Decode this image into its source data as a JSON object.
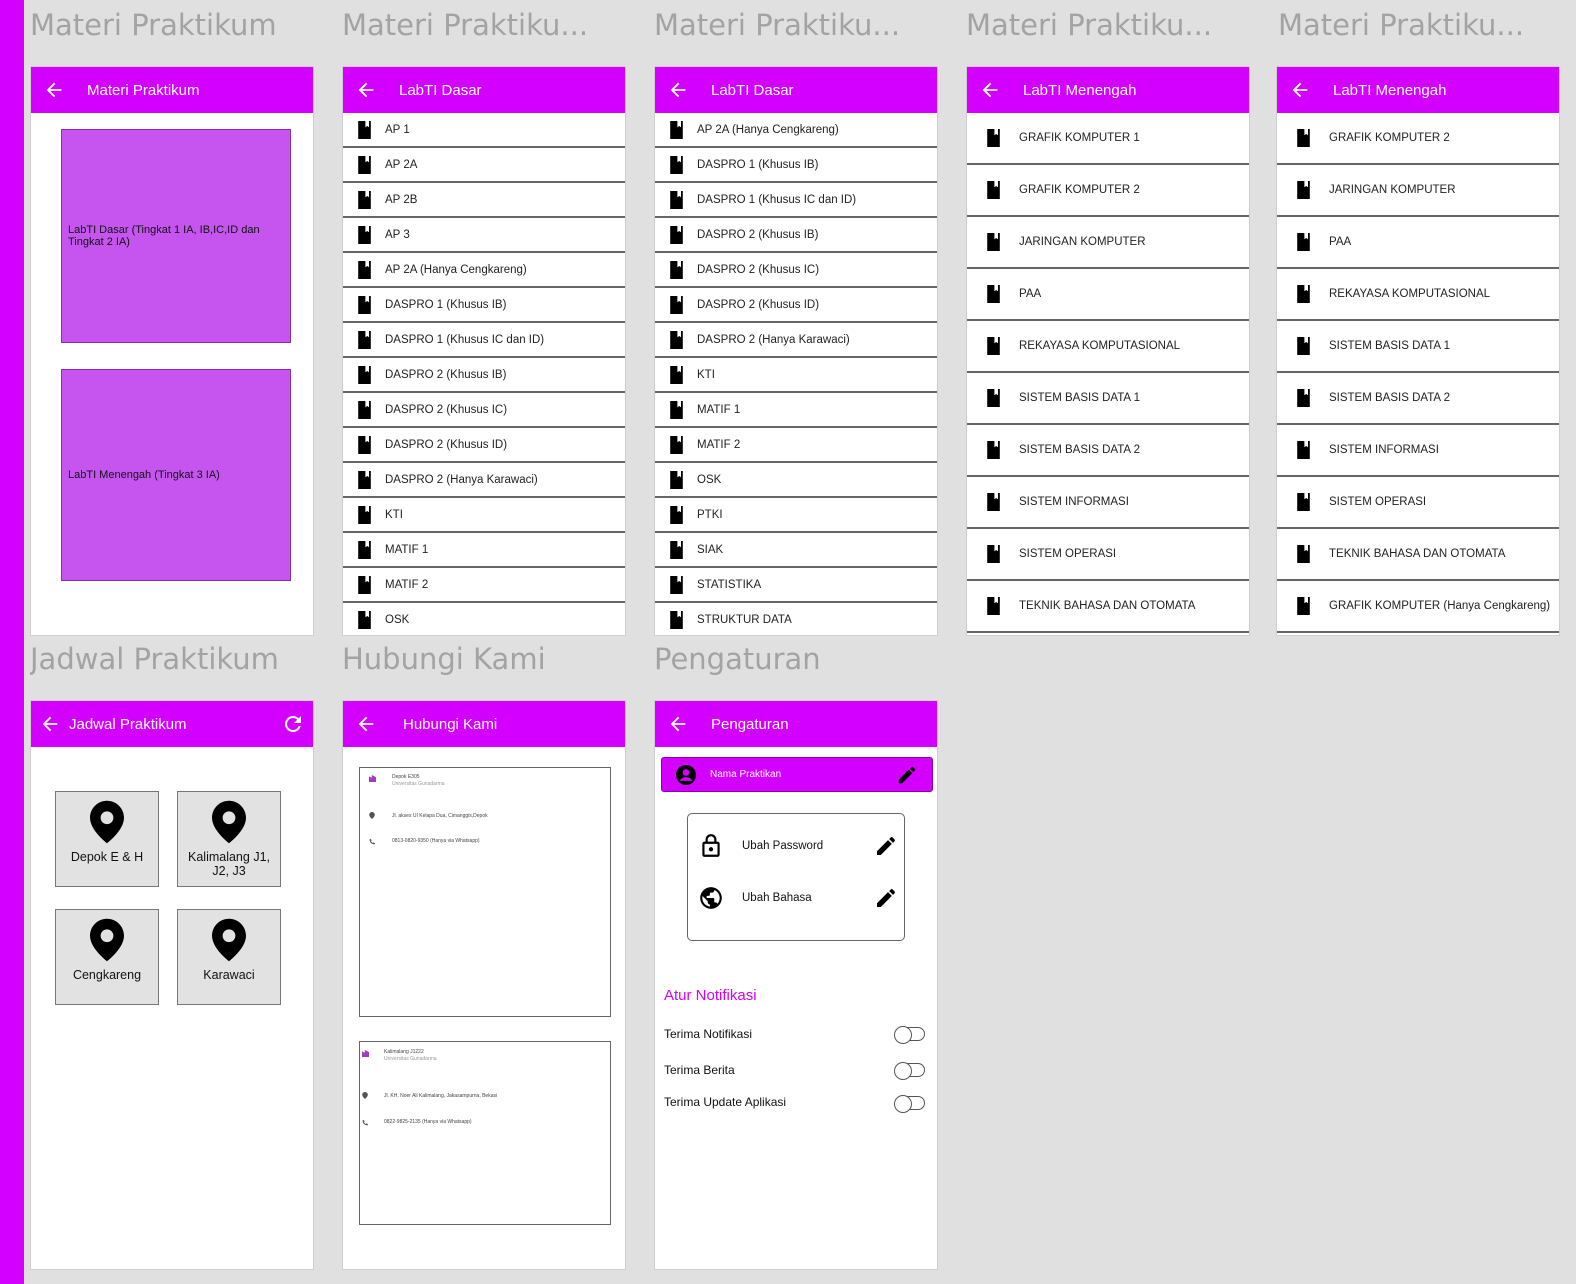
{
  "frames": {
    "materi": {
      "title": "Materi Praktikum",
      "appbar": "Materi Praktikum",
      "cards": [
        "LabTI Dasar (Tingkat 1 IA, IB,IC,ID dan Tingkat 2 IA)",
        "LabTI Menengah (Tingkat 3 IA)"
      ]
    },
    "dasar1": {
      "title": "Materi Praktiku...",
      "appbar": "LabTI Dasar",
      "items": [
        "AP 1",
        "AP 2A",
        "AP 2B",
        "AP 3",
        "AP 2A (Hanya Cengkareng)",
        "DASPRO 1 (Khusus IB)",
        "DASPRO 1 (Khusus IC dan ID)",
        "DASPRO 2 (Khusus IB)",
        "DASPRO 2 (Khusus IC)",
        "DASPRO 2 (Khusus ID)",
        "DASPRO 2 (Hanya Karawaci)",
        "KTI",
        "MATIF 1",
        "MATIF 2",
        "OSK"
      ]
    },
    "dasar2": {
      "title": "Materi Praktiku...",
      "appbar": "LabTI Dasar",
      "items": [
        "AP 2A (Hanya Cengkareng)",
        "DASPRO 1 (Khusus IB)",
        "DASPRO 1 (Khusus IC dan ID)",
        "DASPRO 2 (Khusus IB)",
        "DASPRO 2 (Khusus IC)",
        "DASPRO 2 (Khusus ID)",
        "DASPRO 2 (Hanya Karawaci)",
        "KTI",
        "MATIF 1",
        "MATIF 2",
        "OSK",
        "PTKI",
        "SIAK",
        "STATISTIKA",
        "STRUKTUR DATA"
      ]
    },
    "menengah1": {
      "title": "Materi Praktiku...",
      "appbar": "LabTI Menengah",
      "items": [
        "GRAFIK KOMPUTER 1",
        "GRAFIK KOMPUTER 2",
        "JARINGAN KOMPUTER",
        "PAA",
        "REKAYASA KOMPUTASIONAL",
        "SISTEM BASIS DATA 1",
        "SISTEM BASIS DATA 2",
        "SISTEM INFORMASI",
        "SISTEM OPERASI",
        "TEKNIK BAHASA DAN OTOMATA"
      ]
    },
    "menengah2": {
      "title": "Materi Praktiku...",
      "appbar": "LabTI Menengah",
      "items": [
        "GRAFIK KOMPUTER 2",
        "JARINGAN KOMPUTER",
        "PAA",
        "REKAYASA KOMPUTASIONAL",
        "SISTEM BASIS DATA 1",
        "SISTEM BASIS DATA 2",
        "SISTEM INFORMASI",
        "SISTEM OPERASI",
        "TEKNIK BAHASA DAN OTOMATA",
        "GRAFIK KOMPUTER (Hanya Cengkareng)"
      ]
    },
    "jadwal": {
      "title": "Jadwal Praktikum",
      "appbar": "Jadwal Praktikum",
      "locations": [
        "Depok E & H",
        "Kalimalang J1, J2, J3",
        "Cengkareng",
        "Karawaci"
      ]
    },
    "hubungi": {
      "title": "Hubungi Kami",
      "appbar": "Hubungi Kami",
      "contacts": [
        {
          "name": "Depok E305",
          "org": "Universitas Gunadarma",
          "address": "Jl. akses UI Kelapa Dua, Cimanggis,Depok",
          "phone": "0813-0820-9350 (Hanya via Whatsapp)"
        },
        {
          "name": "Kalimalang J1222",
          "org": "Universitas Gunadarma",
          "address": "Jl. KH. Noer Ali Kalimalang, Jakasampurna, Bekasi",
          "phone": "0822-9825-2135 (Hanya via Whatsapp)"
        }
      ]
    },
    "pengaturan": {
      "title": "Pengaturan",
      "appbar": "Pengaturan",
      "profile_name": "Nama Praktikan",
      "change_password": "Ubah Password",
      "change_language": "Ubah Bahasa",
      "notif_heading": "Atur Notifikasi",
      "toggles": [
        "Terima Notifikasi",
        "Terima Berita",
        "Terima Update Aplikasi"
      ]
    }
  },
  "colors": {
    "accent": "#d400ff",
    "card": "#c655f0",
    "canvas": "#e0e0e0"
  }
}
